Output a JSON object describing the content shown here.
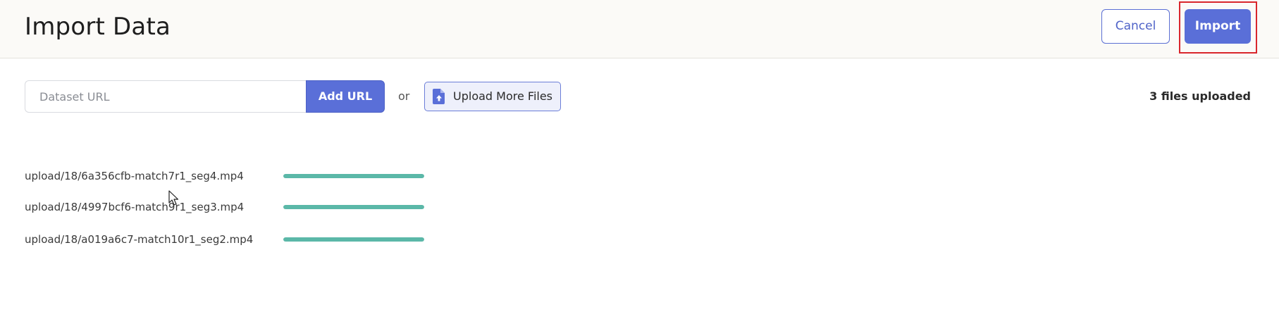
{
  "header": {
    "title": "Import Data",
    "cancel_label": "Cancel",
    "import_label": "Import"
  },
  "toolbar": {
    "url_placeholder": "Dataset URL",
    "url_value": "",
    "add_url_label": "Add URL",
    "or_text": "or",
    "upload_label": "Upload More Files",
    "upload_icon": "file-upload-icon",
    "upload_count": "3 files uploaded"
  },
  "files": [
    {
      "name": "upload/18/6a356cfb-match7r1_seg4.mp4",
      "progress": 1.0
    },
    {
      "name": "upload/18/4997bcf6-match9r1_seg3.mp4",
      "progress": 1.0
    },
    {
      "name": "upload/18/a019a6c7-match10r1_seg2.mp4",
      "progress": 1.0
    }
  ],
  "colors": {
    "accent": "#5a6fd8",
    "progress": "#5bb8a8",
    "highlight": "#d9262c",
    "header_bg": "#fbfaf7"
  }
}
